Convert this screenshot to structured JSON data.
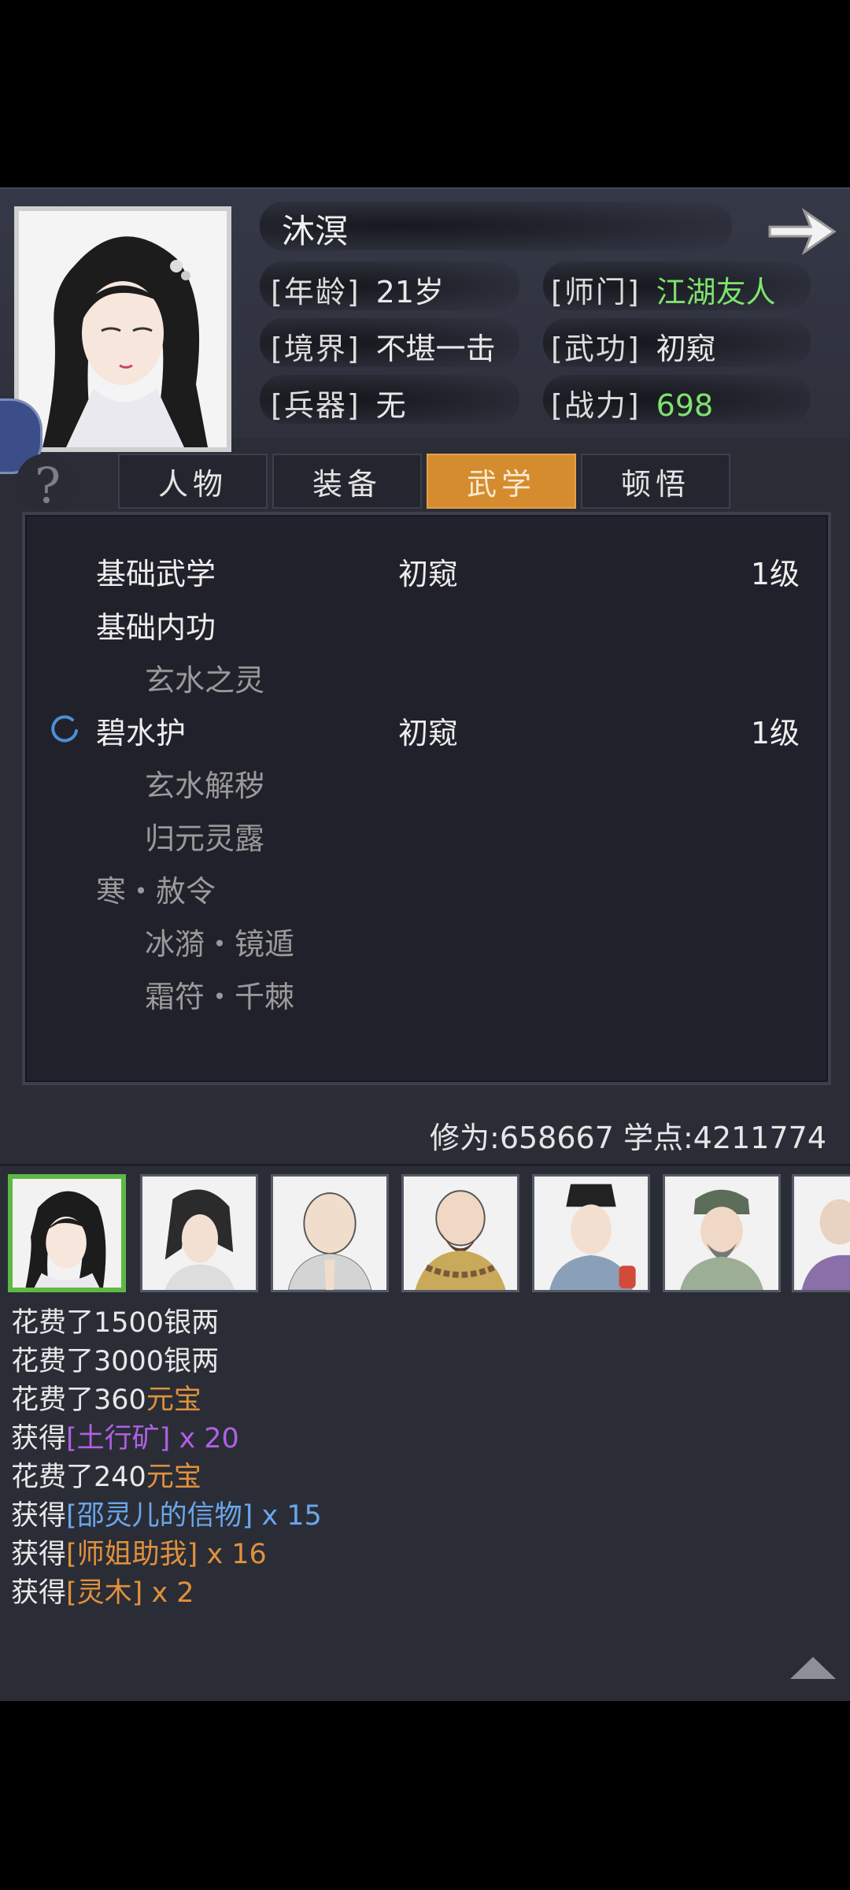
{
  "profile": {
    "name": "沐溟",
    "stats": [
      {
        "label": "[年龄]",
        "value": "21岁"
      },
      {
        "label": "[师门]",
        "value": "江湖友人",
        "value_color": "#7ee36e"
      },
      {
        "label": "[境界]",
        "value": "不堪一击"
      },
      {
        "label": "[武功]",
        "value": "初窥"
      },
      {
        "label": "[兵器]",
        "value": "无"
      },
      {
        "label": "[战力]",
        "value": "698",
        "value_color": "#7ee36e"
      }
    ]
  },
  "tabs": [
    {
      "label": "人物",
      "active": false
    },
    {
      "label": "装备",
      "active": false
    },
    {
      "label": "武学",
      "active": true
    },
    {
      "label": "顿悟",
      "active": false
    }
  ],
  "martial_list": [
    {
      "name": "基础武学",
      "rank": "初窥",
      "level": "1级",
      "type": "main"
    },
    {
      "name": "基础内功",
      "rank": "",
      "level": "",
      "type": "main"
    },
    {
      "name": "玄水之灵",
      "rank": "",
      "level": "",
      "type": "sub"
    },
    {
      "name": "碧水护",
      "rank": "初窥",
      "level": "1级",
      "type": "main",
      "loading": true
    },
    {
      "name": "玄水解秽",
      "rank": "",
      "level": "",
      "type": "sub"
    },
    {
      "name": "归元灵露",
      "rank": "",
      "level": "",
      "type": "sub"
    },
    {
      "name": "寒・赦令",
      "rank": "",
      "level": "",
      "type": "main-dim"
    },
    {
      "name": "冰漪・镜遁",
      "rank": "",
      "level": "",
      "type": "sub"
    },
    {
      "name": "霜符・千棘",
      "rank": "",
      "level": "",
      "type": "sub"
    }
  ],
  "cultivation": {
    "label": "修为:658667  学点:4211774"
  },
  "characters": [
    {
      "icon": "heroine-portrait",
      "selected": true
    },
    {
      "icon": "swordsman-portrait",
      "selected": false
    },
    {
      "icon": "monk-portrait",
      "selected": false
    },
    {
      "icon": "bearded-monk-portrait",
      "selected": false
    },
    {
      "icon": "official-portrait",
      "selected": false
    },
    {
      "icon": "elder-portrait",
      "selected": false
    },
    {
      "icon": "partial-portrait",
      "selected": false
    }
  ],
  "log": [
    {
      "prefix": "花费了1500",
      "highlight": "银两",
      "suffix": "",
      "color": "white"
    },
    {
      "prefix": "花费了3000",
      "highlight": "银两",
      "suffix": "",
      "color": "white"
    },
    {
      "prefix": "花费了360",
      "highlight": "元宝",
      "suffix": "",
      "color": "orange"
    },
    {
      "prefix": "获得",
      "highlight": "[土行矿]",
      "suffix": " x 20",
      "color": "purple"
    },
    {
      "prefix": "花费了240",
      "highlight": "元宝",
      "suffix": "",
      "color": "orange"
    },
    {
      "prefix": "获得",
      "highlight": "[邵灵儿的信物]",
      "suffix": " x 15",
      "color": "blue"
    },
    {
      "prefix": "获得",
      "highlight": "[师姐助我]",
      "suffix": " x 16",
      "color": "orange"
    },
    {
      "prefix": "获得",
      "highlight": "[灵木]",
      "suffix": " x 2",
      "color": "orange"
    }
  ],
  "colors": {
    "accent_tab": "#d48c2e",
    "selected_border": "#5fb845",
    "green_text": "#7ee36e"
  }
}
